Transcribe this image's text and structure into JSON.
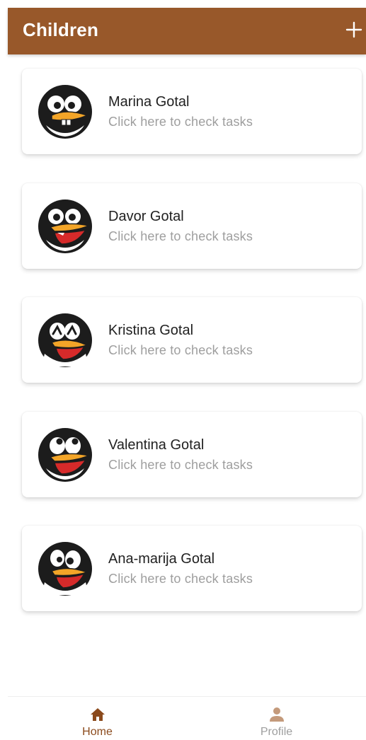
{
  "header": {
    "title": "Children",
    "add_icon": "plus-icon"
  },
  "children": [
    {
      "name": "Marina Gotal",
      "subtitle": "Click here to check tasks",
      "avatar": "penguin-buck-teeth-avatar"
    },
    {
      "name": "Davor Gotal",
      "subtitle": "Click here to check tasks",
      "avatar": "penguin-laughing-avatar"
    },
    {
      "name": "Kristina Gotal",
      "subtitle": "Click here to check tasks",
      "avatar": "penguin-happy-closed-eyes-avatar"
    },
    {
      "name": "Valentina Gotal",
      "subtitle": "Click here to check tasks",
      "avatar": "penguin-looking-up-avatar"
    },
    {
      "name": "Ana-marija Gotal",
      "subtitle": "Click here to check tasks",
      "avatar": "penguin-surprised-avatar"
    }
  ],
  "bottom_nav": {
    "items": [
      {
        "label": "Home",
        "icon": "home-icon",
        "active": true
      },
      {
        "label": "Profile",
        "icon": "person-icon",
        "active": false
      }
    ]
  },
  "colors": {
    "primary": "#98582a",
    "active_nav": "#8b4a1c",
    "inactive_nav": "#9e9e9e",
    "text": "#212121",
    "subtitle": "#9e9e9e",
    "beak": "#f3a528"
  }
}
